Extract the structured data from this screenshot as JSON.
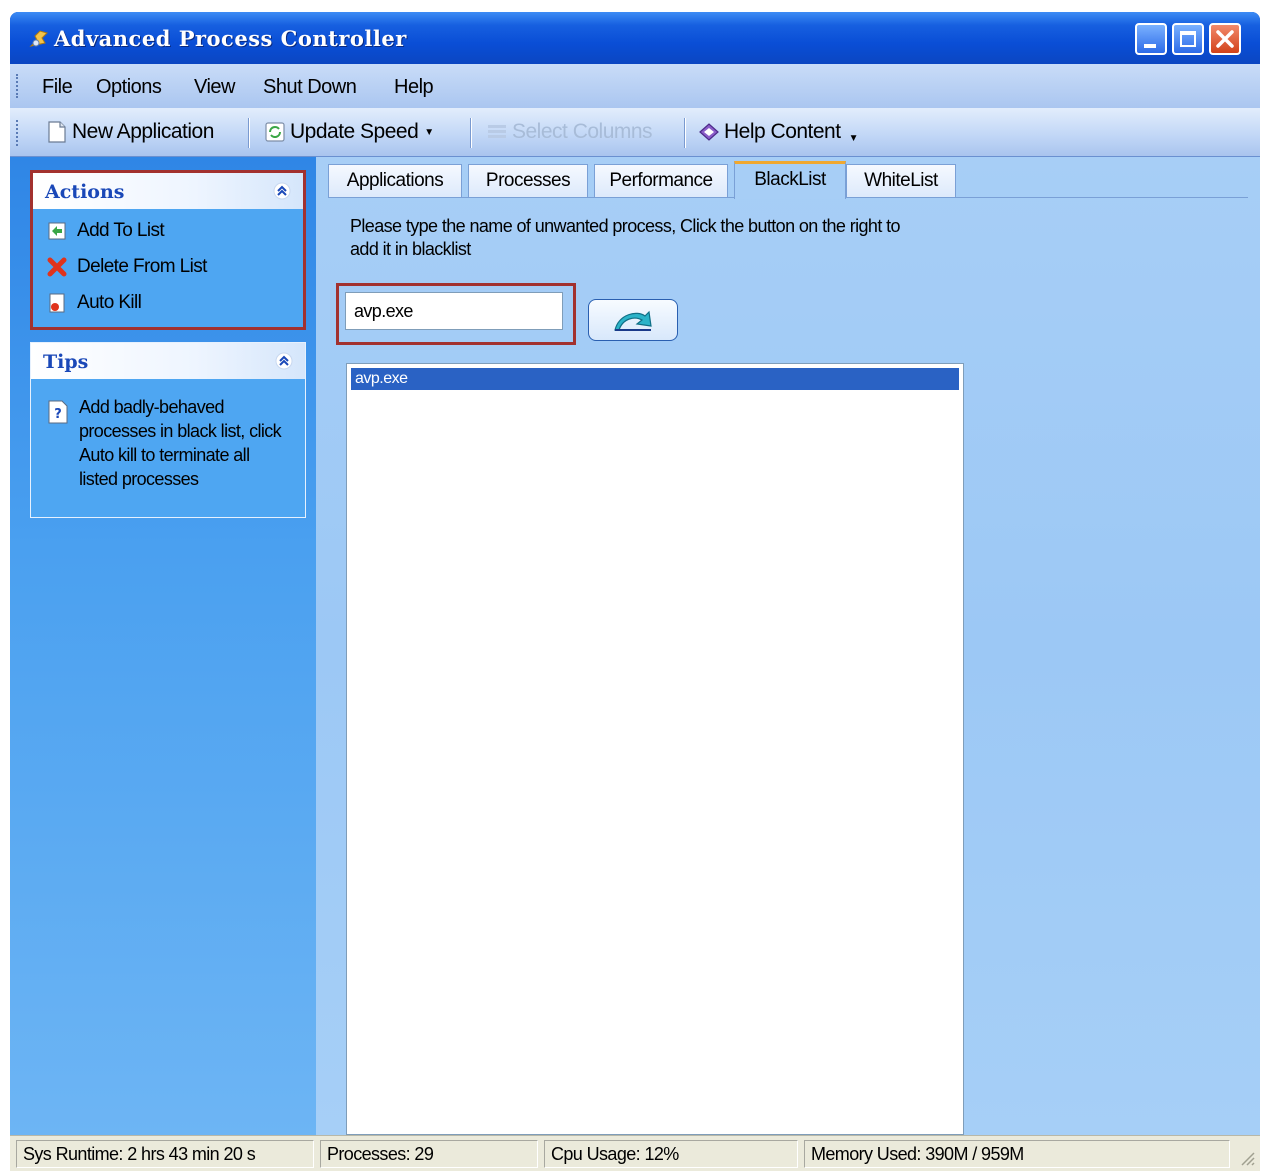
{
  "window": {
    "title": "Advanced Process Controller",
    "controls": {
      "minimize": "minimize-button",
      "maximize": "maximize-button",
      "close": "close-button"
    }
  },
  "menu": [
    "File",
    "Options",
    "View",
    "Shut Down",
    "Help"
  ],
  "toolbar": {
    "new_application": "New Application",
    "update_speed": "Update Speed",
    "select_columns": "Select Columns",
    "help_content": "Help Content"
  },
  "sidebar": {
    "actions": {
      "title": "Actions",
      "items": [
        "Add To List",
        "Delete From List",
        "Auto Kill"
      ]
    },
    "tips": {
      "title": "Tips",
      "text": "Add badly-behaved processes in black list, click Auto kill to terminate all listed processes"
    }
  },
  "tabs": [
    "Applications",
    "Processes",
    "Performance",
    "BlackList",
    "WhiteList"
  ],
  "active_tab": "BlackList",
  "blacklist": {
    "description": "Please type the name of unwanted process, Click the button on the right to add it in blacklist",
    "input_value": "avp.exe",
    "items": [
      "avp.exe"
    ]
  },
  "status": {
    "runtime": "Sys Runtime: 2 hrs 43 min 20 s",
    "processes": "Processes: 29",
    "cpu": "Cpu Usage: 12%",
    "memory": "Memory Used: 390M / 959M"
  },
  "colors": {
    "title_blue": "#0a4ed6",
    "highlight_red": "#a2312f",
    "selection": "#2a62c4",
    "tab_accent": "#f0a830"
  }
}
